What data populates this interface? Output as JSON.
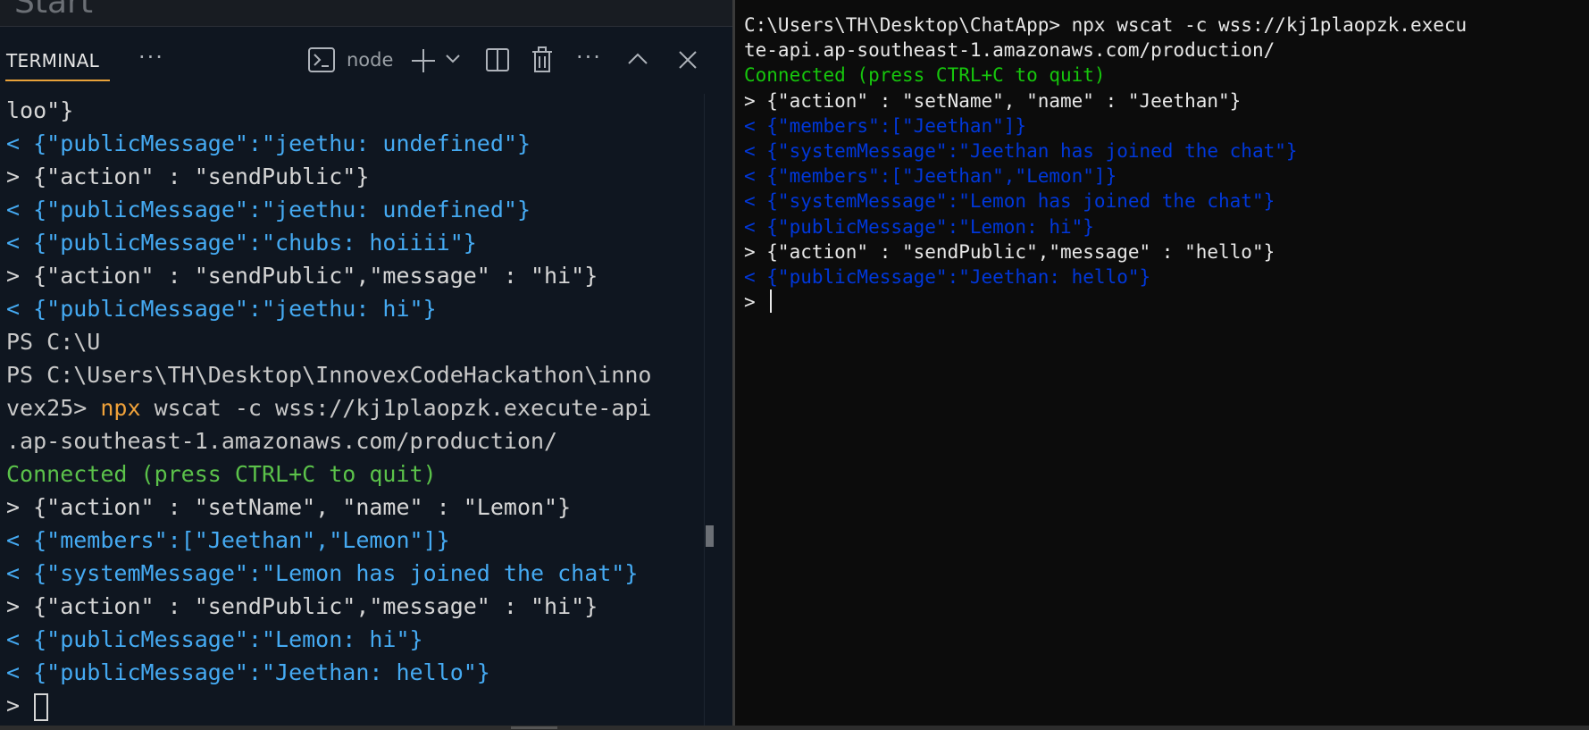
{
  "editor": {
    "title": "Start"
  },
  "panel": {
    "tab_label": "TERMINAL",
    "more_label": "···",
    "shell_label": "node",
    "more2_label": "···"
  },
  "left_terminal": {
    "lines": [
      {
        "text": "loo\"}",
        "style": "white"
      },
      {
        "text": "< {\"publicMessage\":\"jeethu: undefined\"}",
        "style": "blue"
      },
      {
        "text": "> {\"action\" : \"sendPublic\"}",
        "style": "white"
      },
      {
        "text": "< {\"publicMessage\":\"jeethu: undefined\"}",
        "style": "blue"
      },
      {
        "text": "< {\"publicMessage\":\"chubs: hoiiii\"}",
        "style": "blue"
      },
      {
        "text": "> {\"action\" : \"sendPublic\",\"message\" : \"hi\"}",
        "style": "white"
      },
      {
        "text": "< {\"publicMessage\":\"jeethu: hi\"}",
        "style": "blue"
      },
      {
        "text": "PS C:\\U",
        "style": "grey"
      },
      {
        "text": "PS C:\\Users\\TH\\Desktop\\InnovexCodeHackathon\\inno",
        "style": "grey"
      },
      {
        "segments": [
          {
            "text": "vex25> ",
            "style": "grey"
          },
          {
            "text": "npx",
            "style": "orange"
          },
          {
            "text": " wscat ",
            "style": "grey"
          },
          {
            "text": "-c",
            "style": "grey"
          },
          {
            "text": " wss://kj1plaopzk.execute-api",
            "style": "grey"
          }
        ]
      },
      {
        "text": ".ap-southeast-1.amazonaws.com/production/",
        "style": "grey"
      },
      {
        "text": "Connected (press CTRL+C to quit)",
        "style": "green"
      },
      {
        "text": "> {\"action\" : \"setName\", \"name\" : \"Lemon\"}",
        "style": "white"
      },
      {
        "text": "< {\"members\":[\"Jeethan\",\"Lemon\"]}",
        "style": "blue"
      },
      {
        "text": "< {\"systemMessage\":\"Lemon has joined the chat\"}",
        "style": "blue"
      },
      {
        "text": "> {\"action\" : \"sendPublic\",\"message\" : \"hi\"}",
        "style": "white"
      },
      {
        "text": "< {\"publicMessage\":\"Lemon: hi\"}",
        "style": "blue"
      },
      {
        "text": "< {\"publicMessage\":\"Jeethan: hello\"}",
        "style": "blue"
      },
      {
        "text": "> ",
        "style": "white"
      }
    ]
  },
  "right_terminal": {
    "lines": [
      {
        "text": "C:\\Users\\TH\\Desktop\\ChatApp> npx wscat -c wss://kj1plaopzk.execu",
        "style": "white"
      },
      {
        "text": "te-api.ap-southeast-1.amazonaws.com/production/",
        "style": "white"
      },
      {
        "text": "Connected (press CTRL+C to quit)",
        "style": "green"
      },
      {
        "text": "> {\"action\" : \"setName\", \"name\" : \"Jeethan\"}",
        "style": "white"
      },
      {
        "text": "< {\"members\":[\"Jeethan\"]}",
        "style": "blue"
      },
      {
        "text": "< {\"systemMessage\":\"Jeethan has joined the chat\"}",
        "style": "blue"
      },
      {
        "text": "< {\"members\":[\"Jeethan\",\"Lemon\"]}",
        "style": "blue"
      },
      {
        "text": "< {\"systemMessage\":\"Lemon has joined the chat\"}",
        "style": "blue"
      },
      {
        "text": "< {\"publicMessage\":\"Lemon: hi\"}",
        "style": "blue"
      },
      {
        "text": "> {\"action\" : \"sendPublic\",\"message\" : \"hello\"}",
        "style": "white"
      },
      {
        "text": "< {\"publicMessage\":\"Jeethan: hello\"}",
        "style": "blue"
      },
      {
        "text": "> ",
        "style": "white"
      }
    ]
  },
  "icons": {
    "terminal": "terminal-icon",
    "plus": "plus-icon",
    "chevron": "chevron-down-icon",
    "split": "split-pane-icon",
    "trash": "trash-icon",
    "up": "chevron-up-icon",
    "close": "close-icon"
  },
  "colors": {
    "left_background": "#0f1620",
    "right_background": "#0c0c0c",
    "vscode_blue_text": "#45aaf2",
    "vscode_green_text": "#5bc24a",
    "vscode_orange_text": "#f0a23a",
    "console_green_text": "#16c60c",
    "console_blue_text": "#0037da",
    "tab_accent": "#e8a23a"
  }
}
